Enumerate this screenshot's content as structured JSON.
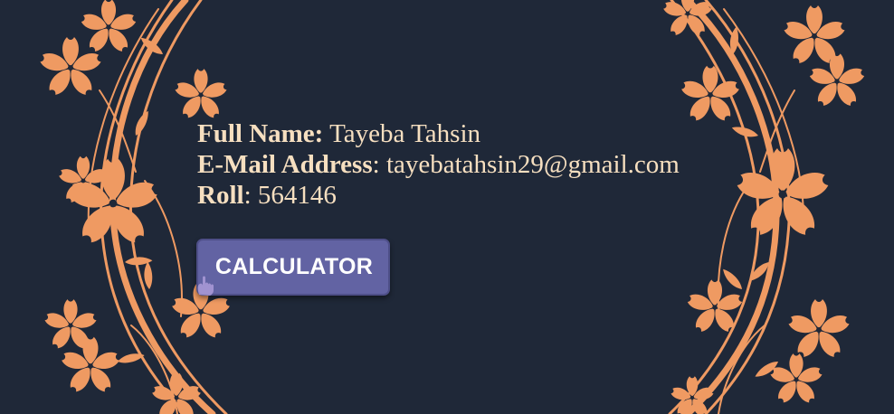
{
  "profile": {
    "full_name_label": "Full Name:",
    "full_name_value": " Tayeba Tahsin",
    "email_label": "E-Mail Address",
    "email_value": ": tayebatahsin29@gmail.com",
    "roll_label": "Roll",
    "roll_value": ": 564146"
  },
  "actions": {
    "calculator_label": "CALCULATOR"
  },
  "colors": {
    "background": "#1f2838",
    "floral": "#ef9a62",
    "text": "#f6dfc0",
    "button": "#6263a3"
  },
  "icons": {
    "decoration": "floral-vine-border",
    "cursor": "hand-pointer-icon"
  }
}
